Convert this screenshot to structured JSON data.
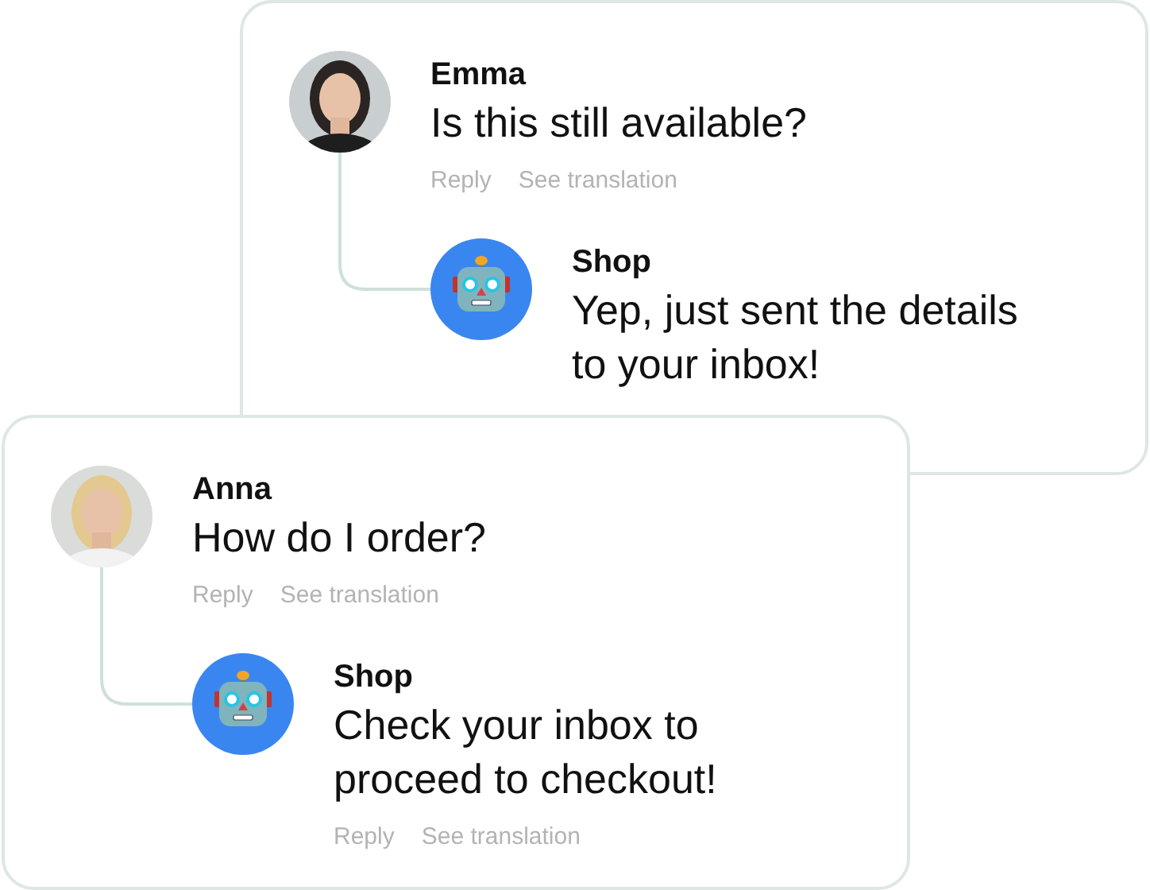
{
  "cards": [
    {
      "comment": {
        "author": "Emma",
        "avatar": {
          "kind": "person"
        },
        "text": "Is this still available?",
        "actions": [
          "Reply",
          "See translation"
        ]
      },
      "reply": {
        "author": "Shop",
        "avatar": {
          "kind": "bot"
        },
        "text": "Yep, just sent the details\nto your inbox!"
      }
    },
    {
      "comment": {
        "author": "Anna",
        "avatar": {
          "kind": "person"
        },
        "text": "How do I order?",
        "actions": [
          "Reply",
          "See translation"
        ]
      },
      "reply": {
        "author": "Shop",
        "avatar": {
          "kind": "bot"
        },
        "text": "Check your inbox to\nproceed to checkout!",
        "actions": [
          "Reply",
          "See translation"
        ]
      }
    }
  ]
}
